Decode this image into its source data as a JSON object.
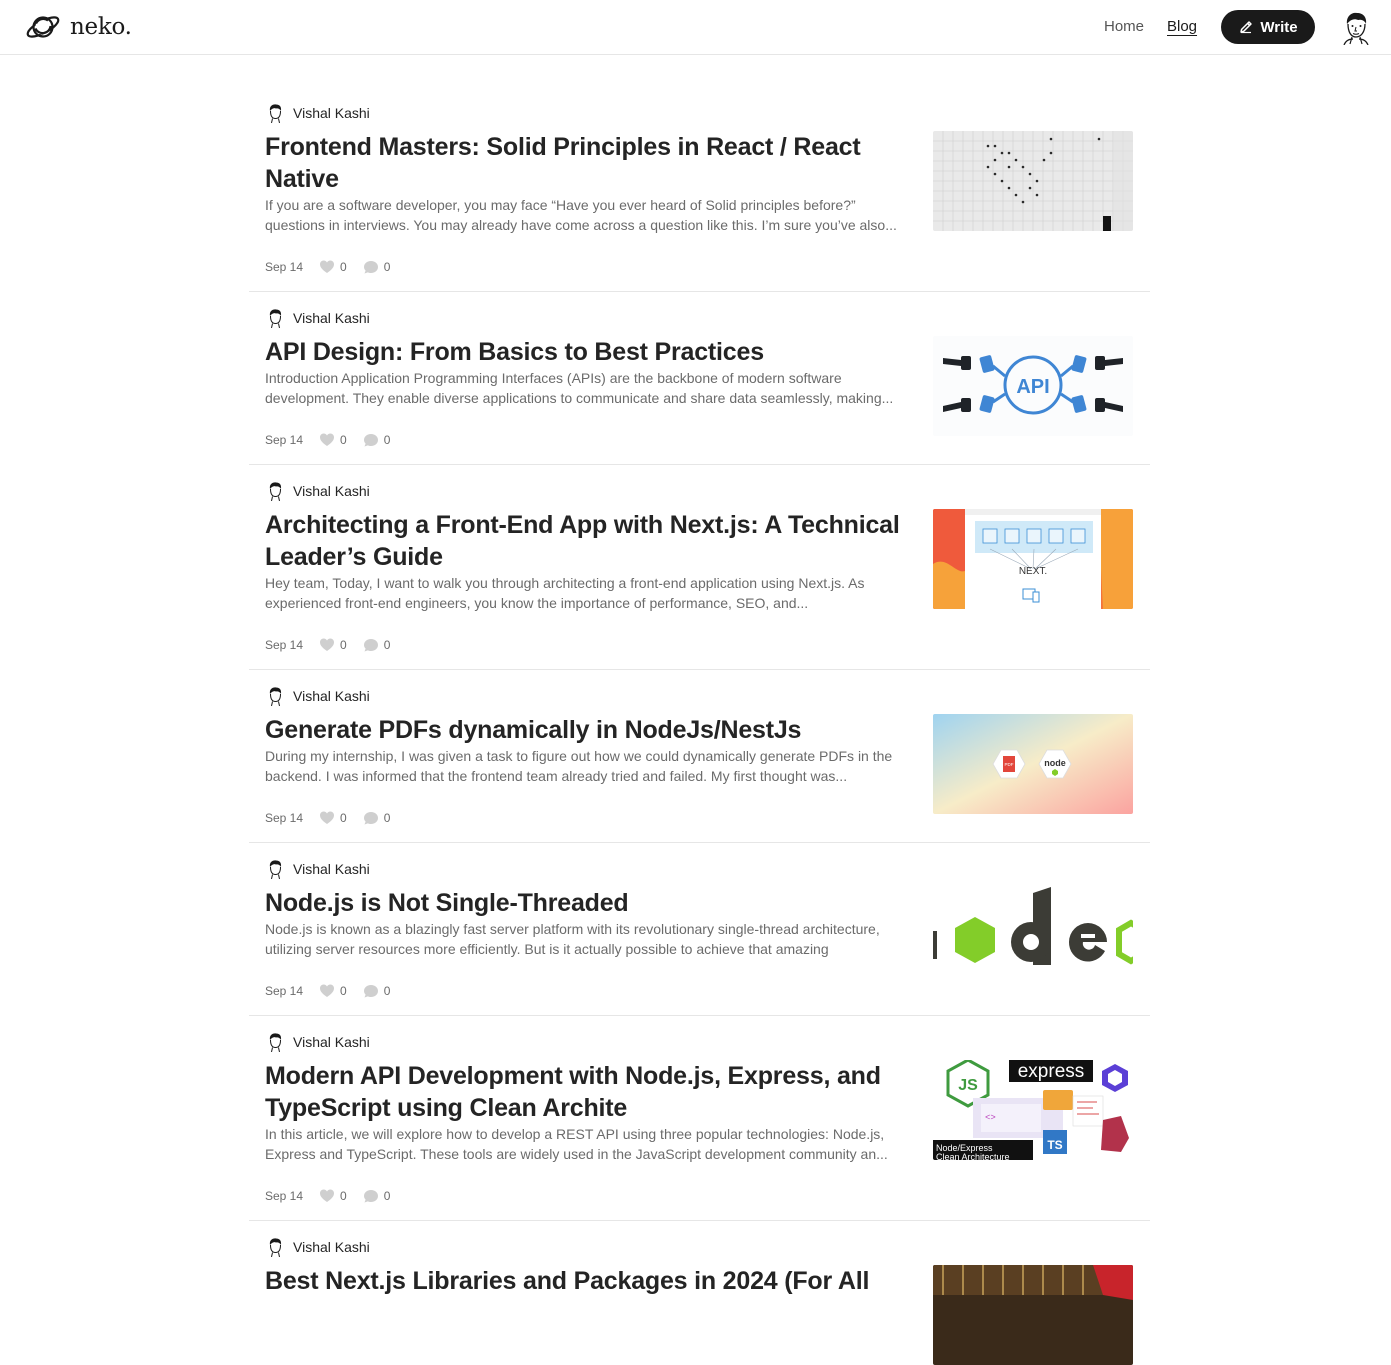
{
  "header": {
    "logo_text": "neko.",
    "logo_icon": "planet-icon",
    "nav": {
      "home_label": "Home",
      "blog_label": "Blog"
    },
    "write_label": "Write",
    "write_icon": "pencil-icon"
  },
  "posts": [
    {
      "author": "Vishal Kashi",
      "title": "Frontend Masters: Solid Principles in React / React Native",
      "excerpt": "If you are a software developer, you may face “Have you ever heard of Solid principles before?” questions in interviews. You may already have come across a question like this. I’m sure you’ve also...",
      "date": "Sep 14",
      "likes": "0",
      "comments": "0"
    },
    {
      "author": "Vishal Kashi",
      "title": "API Design: From Basics to Best Practices",
      "excerpt": "Introduction Application Programming Interfaces (APIs) are the backbone of modern software development. They enable diverse applications to communicate and share data seamlessly, making...",
      "date": "Sep 14",
      "likes": "0",
      "comments": "0",
      "thumb_text": "API"
    },
    {
      "author": "Vishal Kashi",
      "title": "Architecting a Front-End App with Next.js: A Technical Leader’s Guide",
      "excerpt": "Hey team, Today, I want to walk you through architecting a front-end application using Next.js. As experienced front-end engineers, you know the importance of performance, SEO, and...",
      "date": "Sep 14",
      "likes": "0",
      "comments": "0",
      "thumb_text": "NEXT."
    },
    {
      "author": "Vishal Kashi",
      "title": "Generate PDFs dynamically in NodeJs/NestJs",
      "excerpt": "During my internship, I was given a task to figure out how we could dynamically generate PDFs in the backend. I was informed that the frontend team already tried and failed. My first thought was...",
      "date": "Sep 14",
      "likes": "0",
      "comments": "0",
      "thumb_texts": [
        "PDF",
        "node"
      ]
    },
    {
      "author": "Vishal Kashi",
      "title": "Node.js is Not Single-Threaded",
      "excerpt": "Node.js is known as a blazingly fast server platform with its revolutionary single-thread architecture, utilizing server resources more efficiently. But is it actually possible to achieve that amazing",
      "date": "Sep 14",
      "likes": "0",
      "comments": "0"
    },
    {
      "author": "Vishal Kashi",
      "title": "Modern API Development with Node.js, Express, and TypeScript using Clean Archite",
      "excerpt": "In this article, we will explore how to develop a REST API using three popular technologies: Node.js, Express and TypeScript. These tools are widely used in the JavaScript development community an...",
      "date": "Sep 14",
      "likes": "0",
      "comments": "0",
      "thumb_texts": [
        "express",
        "JS",
        "Node/Express",
        "Clean Architecture",
        "TS"
      ]
    },
    {
      "author": "Vishal Kashi",
      "title": "Best Next.js Libraries and Packages in 2024 (For All",
      "excerpt": "",
      "date": "",
      "likes": "",
      "comments": ""
    }
  ],
  "icons": {
    "like": "heart-icon",
    "comment": "comment-bubble-icon"
  },
  "colors": {
    "text_primary": "#242424",
    "text_secondary": "#6b6b6b",
    "button_bg": "#1a1a1a",
    "divider": "#e6e6e6",
    "node_green": "#83cd29"
  }
}
